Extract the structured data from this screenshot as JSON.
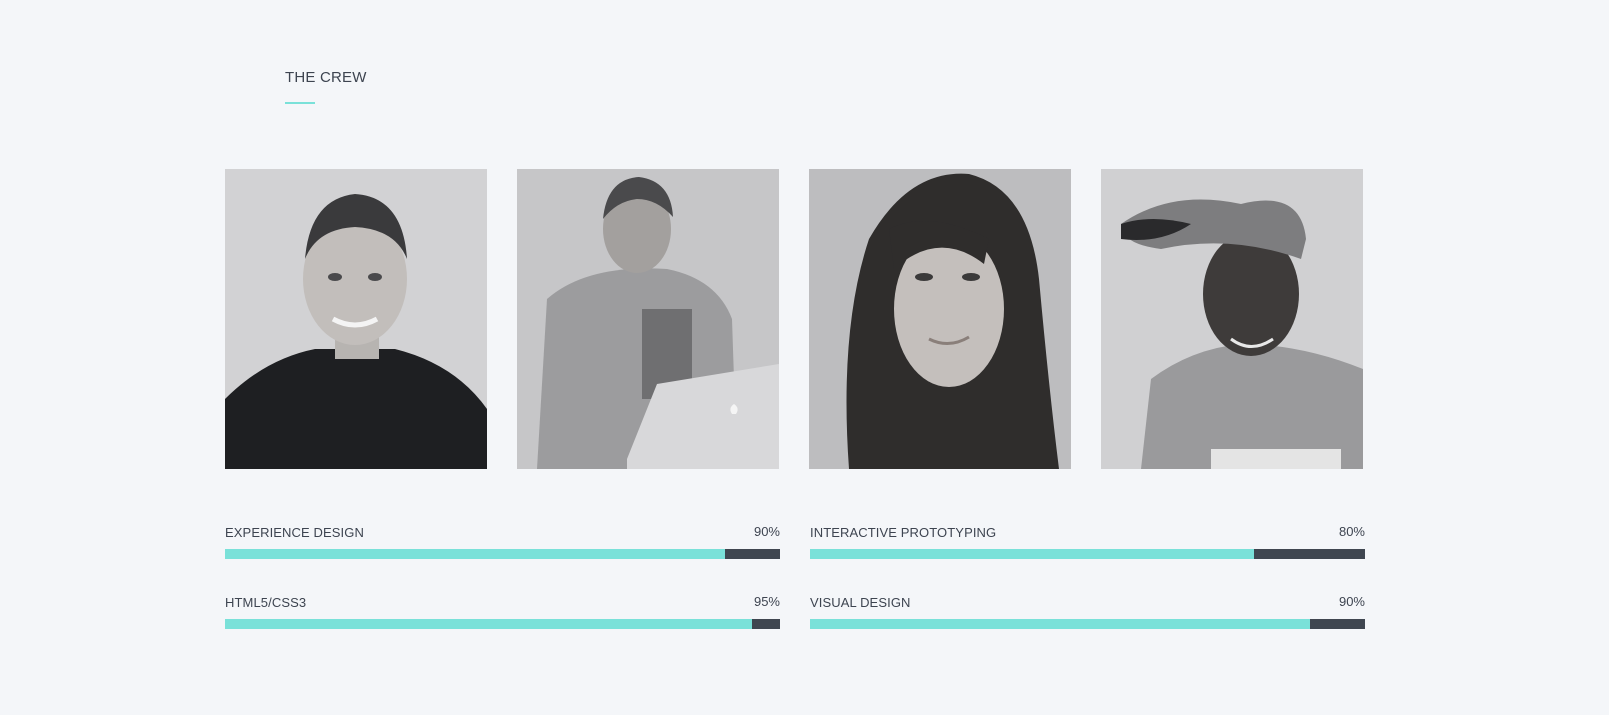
{
  "section": {
    "title": "THE CREW"
  },
  "crew": [
    {
      "role": "portrait",
      "image": "man-black-tshirt-photo"
    },
    {
      "role": "portrait",
      "image": "man-laptop-photo"
    },
    {
      "role": "portrait",
      "image": "woman-long-hair-photo"
    },
    {
      "role": "portrait",
      "image": "man-cap-photo"
    }
  ],
  "skills": [
    {
      "label": "EXPERIENCE DESIGN",
      "value": "90%",
      "percent": 90
    },
    {
      "label": "INTERACTIVE PROTOTYPING",
      "value": "80%",
      "percent": 80
    },
    {
      "label": "HTML5/CSS3",
      "value": "95%",
      "percent": 95
    },
    {
      "label": "VISUAL DESIGN",
      "value": "90%",
      "percent": 90
    }
  ],
  "colors": {
    "background": "#f4f6f9",
    "accent": "#7ae1d9",
    "track": "#3f4650",
    "text": "#3d4450"
  }
}
